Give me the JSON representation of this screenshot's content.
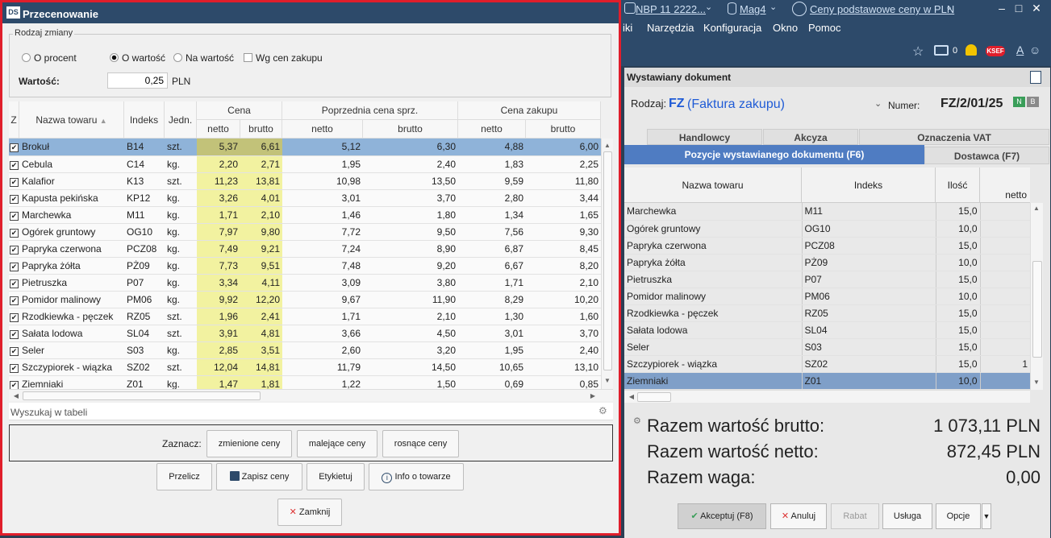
{
  "app": {
    "company": "NBP 11 2222...",
    "warehouse": "Mag4",
    "price_basis": "Ceny podstawowe ceny w PLN",
    "menu": [
      "iki",
      "Narzędzia",
      "Konfiguracja",
      "Okno",
      "Pomoc"
    ],
    "notification_count": "0",
    "ksef_badge": "KSEF",
    "font_label": "A",
    "doc_panel_title": "Wystawiany dokument",
    "doc_type_label": "Rodzaj:",
    "doc_type_code": "FZ",
    "doc_type_name": "(Faktura zakupu)",
    "doc_number_label": "Numer:",
    "doc_number": "FZ/2/01/25",
    "badge_n": "N",
    "badge_b": "B",
    "tabs_top": [
      "Handlowcy",
      "Akcyza",
      "Oznaczenia VAT"
    ],
    "tab_active": "Pozycje wystawianego dokumentu (F6)",
    "tab_other": "Dostawca (F7)",
    "grid_headers": [
      "Nazwa towaru",
      "Indeks",
      "Ilość",
      "netto"
    ],
    "grid_rows": [
      [
        "Marchewka",
        "M11",
        "15,0",
        ""
      ],
      [
        "Ogórek gruntowy",
        "OG10",
        "10,0",
        ""
      ],
      [
        "Papryka czerwona",
        "PCZ08",
        "15,0",
        ""
      ],
      [
        "Papryka żółta",
        "PŻ09",
        "10,0",
        ""
      ],
      [
        "Pietruszka",
        "P07",
        "15,0",
        ""
      ],
      [
        "Pomidor malinowy",
        "PM06",
        "10,0",
        ""
      ],
      [
        "Rzodkiewka - pęczek",
        "RZ05",
        "15,0",
        ""
      ],
      [
        "Sałata lodowa",
        "SL04",
        "15,0",
        ""
      ],
      [
        "Seler",
        "S03",
        "15,0",
        ""
      ],
      [
        "Szczypiorek - wiązka",
        "SZ02",
        "15,0",
        "1"
      ],
      [
        "Ziemniaki",
        "Z01",
        "10,0",
        ""
      ]
    ],
    "totals": [
      {
        "label": "Razem wartość brutto:",
        "value": "1 073,11 PLN"
      },
      {
        "label": "Razem wartość netto:",
        "value": "872,45 PLN"
      },
      {
        "label": "Razem waga:",
        "value": "0,00"
      }
    ],
    "buttons": {
      "accept": "Akceptuj (F8)",
      "cancel": "Anuluj",
      "discount": "Rabat",
      "service": "Usługa",
      "options": "Opcje"
    }
  },
  "dialog": {
    "title": "Przecenowanie",
    "logo": "DS",
    "group_label": "Rodzaj zmiany",
    "options": {
      "percent": "O procent",
      "amount": "O wartość",
      "to_value": "Na wartość",
      "by_purchase": "Wg cen zakupu"
    },
    "value_label": "Wartość:",
    "value": "0,25",
    "currency": "PLN",
    "headers": {
      "z": "Z",
      "name": "Nazwa towaru",
      "index": "Indeks",
      "unit": "Jedn.",
      "price": "Cena",
      "prev_price": "Poprzednia cena sprz.",
      "purchase_price": "Cena zakupu",
      "netto": "netto",
      "brutto": "brutto"
    },
    "rows": [
      [
        "Brokuł",
        "B14",
        "szt.",
        "5,37",
        "6,61",
        "5,12",
        "6,30",
        "4,88",
        "6,00"
      ],
      [
        "Cebula",
        "C14",
        "kg.",
        "2,20",
        "2,71",
        "1,95",
        "2,40",
        "1,83",
        "2,25"
      ],
      [
        "Kalafior",
        "K13",
        "szt.",
        "11,23",
        "13,81",
        "10,98",
        "13,50",
        "9,59",
        "11,80"
      ],
      [
        "Kapusta pekińska",
        "KP12",
        "kg.",
        "3,26",
        "4,01",
        "3,01",
        "3,70",
        "2,80",
        "3,44"
      ],
      [
        "Marchewka",
        "M11",
        "kg.",
        "1,71",
        "2,10",
        "1,46",
        "1,80",
        "1,34",
        "1,65"
      ],
      [
        "Ogórek gruntowy",
        "OG10",
        "kg.",
        "7,97",
        "9,80",
        "7,72",
        "9,50",
        "7,56",
        "9,30"
      ],
      [
        "Papryka czerwona",
        "PCZ08",
        "kg.",
        "7,49",
        "9,21",
        "7,24",
        "8,90",
        "6,87",
        "8,45"
      ],
      [
        "Papryka żółta",
        "PŻ09",
        "kg.",
        "7,73",
        "9,51",
        "7,48",
        "9,20",
        "6,67",
        "8,20"
      ],
      [
        "Pietruszka",
        "P07",
        "kg.",
        "3,34",
        "4,11",
        "3,09",
        "3,80",
        "1,71",
        "2,10"
      ],
      [
        "Pomidor malinowy",
        "PM06",
        "kg.",
        "9,92",
        "12,20",
        "9,67",
        "11,90",
        "8,29",
        "10,20"
      ],
      [
        "Rzodkiewka - pęczek",
        "RZ05",
        "szt.",
        "1,96",
        "2,41",
        "1,71",
        "2,10",
        "1,30",
        "1,60"
      ],
      [
        "Sałata lodowa",
        "SL04",
        "szt.",
        "3,91",
        "4,81",
        "3,66",
        "4,50",
        "3,01",
        "3,70"
      ],
      [
        "Seler",
        "S03",
        "kg.",
        "2,85",
        "3,51",
        "2,60",
        "3,20",
        "1,95",
        "2,40"
      ],
      [
        "Szczypiorek - wiązka",
        "SZ02",
        "szt.",
        "12,04",
        "14,81",
        "11,79",
        "14,50",
        "10,65",
        "13,10"
      ],
      [
        "Ziemniaki",
        "Z01",
        "kg.",
        "1,47",
        "1,81",
        "1,22",
        "1,50",
        "0,69",
        "0,85"
      ]
    ],
    "search_placeholder": "Wyszukaj w tabeli",
    "select_label": "Zaznacz:",
    "select_buttons": [
      "zmienione ceny",
      "malejące ceny",
      "rosnące ceny"
    ],
    "action_buttons": {
      "recalc": "Przelicz",
      "save": "Zapisz ceny",
      "label": "Etykietuj",
      "info": "Info o towarze",
      "close": "Zamknij"
    }
  }
}
